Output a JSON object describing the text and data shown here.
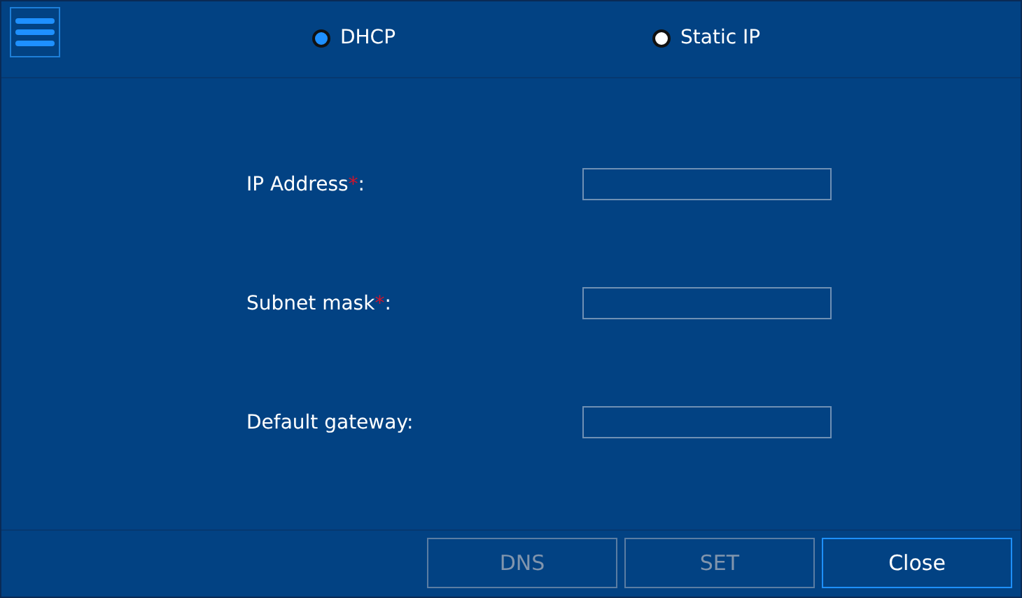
{
  "mode_options": [
    {
      "label": "DHCP",
      "selected": true
    },
    {
      "label": "Static IP",
      "selected": false
    }
  ],
  "fields": [
    {
      "label": "IP Address",
      "required_mark": "*",
      "suffix": ":"
    },
    {
      "label": "Subnet mask",
      "required_mark": "*",
      "suffix": ":"
    },
    {
      "label": "Default gateway",
      "suffix": ":"
    }
  ],
  "buttons": [
    {
      "label": "DNS",
      "disabled": true
    },
    {
      "label": "SET",
      "disabled": true
    },
    {
      "label": "Close",
      "disabled": false
    }
  ]
}
